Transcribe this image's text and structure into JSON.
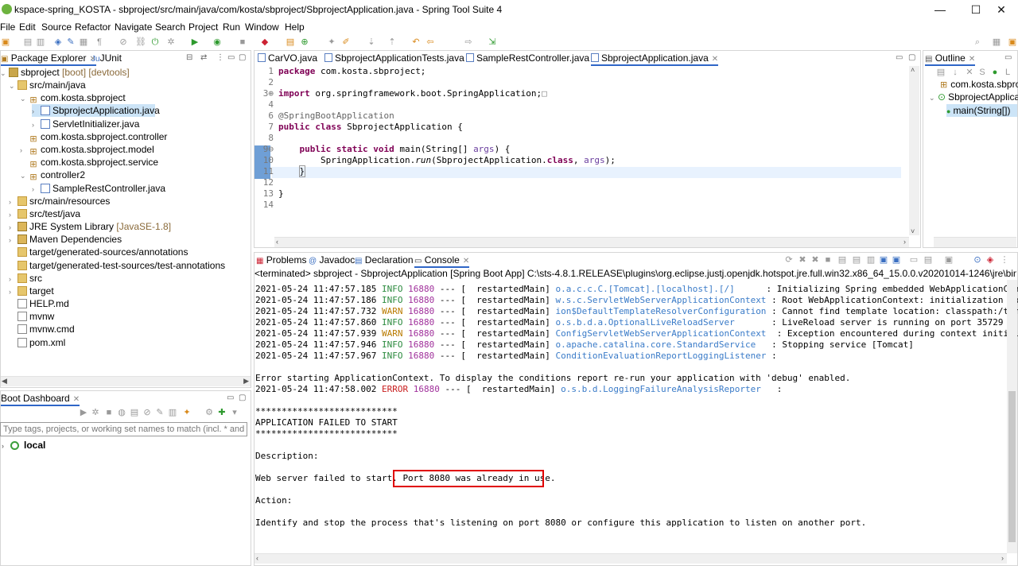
{
  "window": {
    "title": "kspace-spring_KOSTA - sbproject/src/main/java/com/kosta/sbproject/SbprojectApplication.java - Spring Tool Suite 4",
    "minimize": "—",
    "maximize": "☐",
    "close": "✕"
  },
  "menu": [
    "File",
    "Edit",
    "Source",
    "Refactor",
    "Navigate",
    "Search",
    "Project",
    "Run",
    "Window",
    "Help"
  ],
  "package_explorer": {
    "tabs": [
      "Package Explorer",
      "JUnit"
    ],
    "tree": [
      {
        "label": "sbproject",
        "suffix": " [boot] [devtools]"
      },
      {
        "label": "src/main/java"
      },
      {
        "label": "com.kosta.sbproject"
      },
      {
        "label": "SbprojectApplication.java"
      },
      {
        "label": "ServletInitializer.java"
      },
      {
        "label": "com.kosta.sbproject.controller"
      },
      {
        "label": "com.kosta.sbproject.model"
      },
      {
        "label": "com.kosta.sbproject.service"
      },
      {
        "label": "controller2"
      },
      {
        "label": "SampleRestController.java"
      },
      {
        "label": "src/main/resources"
      },
      {
        "label": "src/test/java"
      },
      {
        "label": "JRE System Library",
        "suffix": " [JavaSE-1.8]"
      },
      {
        "label": "Maven Dependencies"
      },
      {
        "label": "target/generated-sources/annotations"
      },
      {
        "label": "target/generated-test-sources/test-annotations"
      },
      {
        "label": "src"
      },
      {
        "label": "target"
      },
      {
        "label": "HELP.md"
      },
      {
        "label": "mvnw"
      },
      {
        "label": "mvnw.cmd"
      },
      {
        "label": "pom.xml"
      }
    ]
  },
  "boot_dashboard": {
    "tab": "Boot Dashboard",
    "filter_placeholder": "Type tags, projects, or working set names to match (incl. * and ? w",
    "local": "local"
  },
  "editor": {
    "tabs": [
      "CarVO.java",
      "SbprojectApplicationTests.java",
      "SampleRestController.java",
      "SbprojectApplication.java"
    ],
    "lines": {
      "l1_kw": "package",
      "l1_rest": " com.kosta.sbproject;",
      "l3_kw": "import",
      "l3_rest": " org.springframework.boot.SpringApplication;",
      "l6": "@SpringBootApplication",
      "l7_kw1": "public",
      "l7_kw2": "class",
      "l7_rest": " SbprojectApplication {",
      "l9_kw": "public static void",
      "l9_rest": " main(String[] ",
      "l9_args": "args",
      "l9_end": ") {",
      "l10_a": "SpringApplication.",
      "l10_run": "run",
      "l10_b": "(SbprojectApplication.",
      "l10_class": "class",
      "l10_c": ", ",
      "l10_args": "args",
      "l10_d": ");",
      "l11": "}",
      "l13": "}"
    }
  },
  "outline": {
    "tab": "Outline",
    "items": [
      "com.kosta.sbproje",
      "SbprojectApplica",
      "main(String[])"
    ]
  },
  "console": {
    "tabs": [
      "Problems",
      "Javadoc",
      "Declaration",
      "Console"
    ],
    "header": "<terminated> sbproject - SbprojectApplication [Spring Boot App] C:\\sts-4.8.1.RELEASE\\plugins\\org.eclipse.justj.openjdk.hotspot.jre.full.win32.x86_64_15.0.0.v20201014-1246\\jre\\bin\\javaw.exe  (2021.",
    "log": [
      {
        "ts": "2021-05-24 11:47:57.185",
        "level": "INFO",
        "pid": "16880",
        "thread": " --- [  restartedMain] ",
        "logger": "o.a.c.c.C.[Tomcat].[localhost].[/]",
        "pad": "      ",
        "msg": ": Initializing Spring embedded WebApplicationContext"
      },
      {
        "ts": "2021-05-24 11:47:57.186",
        "level": "INFO",
        "pid": "16880",
        "thread": " --- [  restartedMain] ",
        "logger": "w.s.c.ServletWebServerApplicationContext",
        "pad": " ",
        "msg": ": Root WebApplicationContext: initialization complet"
      },
      {
        "ts": "2021-05-24 11:47:57.732",
        "level": "WARN",
        "pid": "16880",
        "thread": " --- [  restartedMain] ",
        "logger": "ion$DefaultTemplateResolverConfiguration",
        "pad": " ",
        "msg": ": Cannot find template location: classpath:/template"
      },
      {
        "ts": "2021-05-24 11:47:57.860",
        "level": "INFO",
        "pid": "16880",
        "thread": " --- [  restartedMain] ",
        "logger": "o.s.b.d.a.OptionalLiveReloadServer",
        "pad": "       ",
        "msg": ": LiveReload server is running on port 35729"
      },
      {
        "ts": "2021-05-24 11:47:57.939",
        "level": "WARN",
        "pid": "16880",
        "thread": " --- [  restartedMain] ",
        "logger": "ConfigServletWebServerApplicationContext",
        "pad": "  ",
        "msg": ": Exception encountered during context initializatio"
      },
      {
        "ts": "2021-05-24 11:47:57.946",
        "level": "INFO",
        "pid": "16880",
        "thread": " --- [  restartedMain] ",
        "logger": "o.apache.catalina.core.StandardService",
        "pad": "   ",
        "msg": ": Stopping service [Tomcat]"
      },
      {
        "ts": "2021-05-24 11:47:57.967",
        "level": "INFO",
        "pid": "16880",
        "thread": " --- [  restartedMain] ",
        "logger": "ConditionEvaluationReportLoggingListener",
        "pad": " ",
        "msg": ":"
      }
    ],
    "error_line": "Error starting ApplicationContext. To display the conditions report re-run your application with 'debug' enabled.",
    "error_log": {
      "ts": "2021-05-24 11:47:58.002",
      "level": "ERROR",
      "pid": "16880",
      "thread": " --- [  restartedMain] ",
      "logger": "o.s.b.d.LoggingFailureAnalysisReporter",
      "pad": "   ",
      "msg": ":"
    },
    "stars": "***************************",
    "failed": "APPLICATION FAILED TO START",
    "description_label": "Description:",
    "description_prefix": "Web server failed to start. ",
    "description_highlight": "Port 8080 was already in use.",
    "action_label": "Action:",
    "action_text": "Identify and stop the process that's listening on port 8080 or configure this application to listen on another port."
  }
}
